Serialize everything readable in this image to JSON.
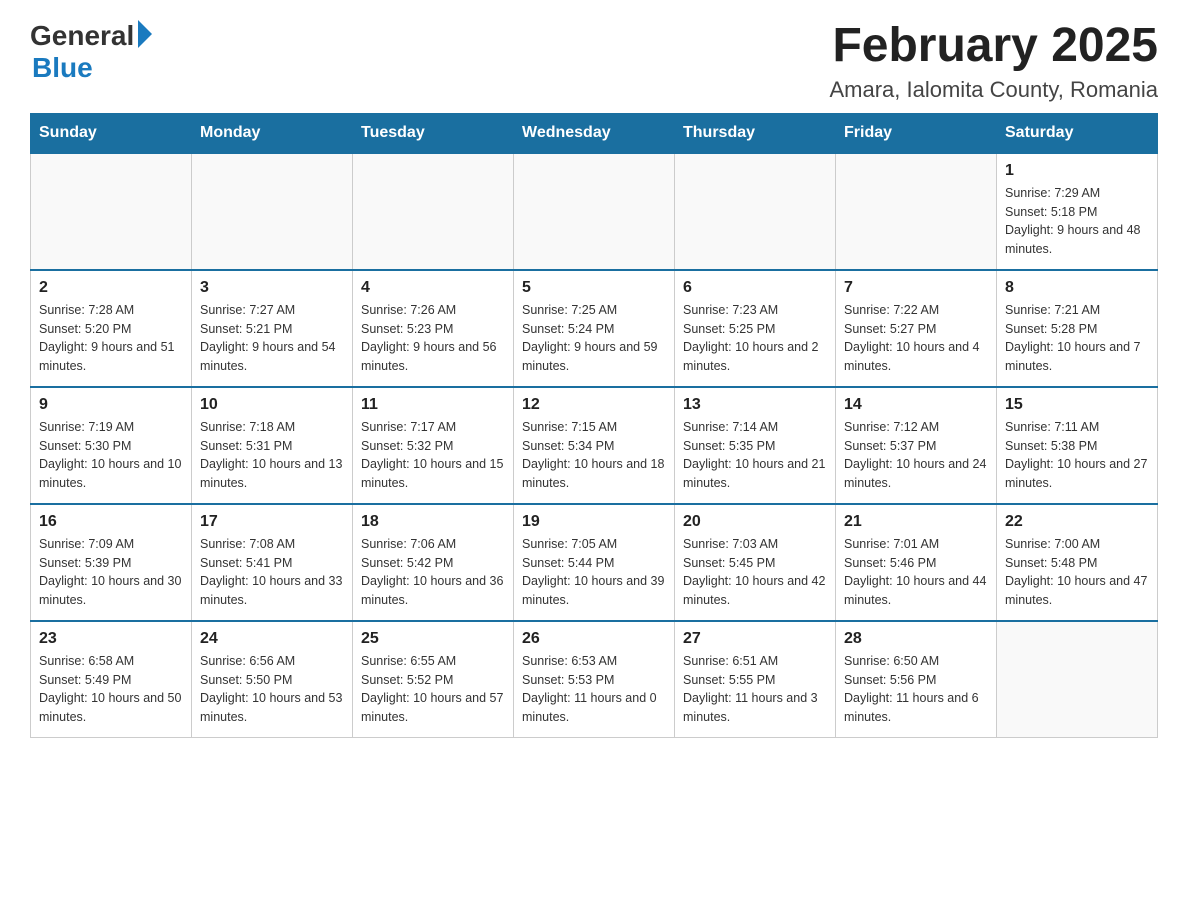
{
  "logo": {
    "general": "General",
    "blue": "Blue"
  },
  "title": "February 2025",
  "location": "Amara, Ialomita County, Romania",
  "days_header": [
    "Sunday",
    "Monday",
    "Tuesday",
    "Wednesday",
    "Thursday",
    "Friday",
    "Saturday"
  ],
  "weeks": [
    [
      {
        "day": "",
        "info": ""
      },
      {
        "day": "",
        "info": ""
      },
      {
        "day": "",
        "info": ""
      },
      {
        "day": "",
        "info": ""
      },
      {
        "day": "",
        "info": ""
      },
      {
        "day": "",
        "info": ""
      },
      {
        "day": "1",
        "info": "Sunrise: 7:29 AM\nSunset: 5:18 PM\nDaylight: 9 hours and 48 minutes."
      }
    ],
    [
      {
        "day": "2",
        "info": "Sunrise: 7:28 AM\nSunset: 5:20 PM\nDaylight: 9 hours and 51 minutes."
      },
      {
        "day": "3",
        "info": "Sunrise: 7:27 AM\nSunset: 5:21 PM\nDaylight: 9 hours and 54 minutes."
      },
      {
        "day": "4",
        "info": "Sunrise: 7:26 AM\nSunset: 5:23 PM\nDaylight: 9 hours and 56 minutes."
      },
      {
        "day": "5",
        "info": "Sunrise: 7:25 AM\nSunset: 5:24 PM\nDaylight: 9 hours and 59 minutes."
      },
      {
        "day": "6",
        "info": "Sunrise: 7:23 AM\nSunset: 5:25 PM\nDaylight: 10 hours and 2 minutes."
      },
      {
        "day": "7",
        "info": "Sunrise: 7:22 AM\nSunset: 5:27 PM\nDaylight: 10 hours and 4 minutes."
      },
      {
        "day": "8",
        "info": "Sunrise: 7:21 AM\nSunset: 5:28 PM\nDaylight: 10 hours and 7 minutes."
      }
    ],
    [
      {
        "day": "9",
        "info": "Sunrise: 7:19 AM\nSunset: 5:30 PM\nDaylight: 10 hours and 10 minutes."
      },
      {
        "day": "10",
        "info": "Sunrise: 7:18 AM\nSunset: 5:31 PM\nDaylight: 10 hours and 13 minutes."
      },
      {
        "day": "11",
        "info": "Sunrise: 7:17 AM\nSunset: 5:32 PM\nDaylight: 10 hours and 15 minutes."
      },
      {
        "day": "12",
        "info": "Sunrise: 7:15 AM\nSunset: 5:34 PM\nDaylight: 10 hours and 18 minutes."
      },
      {
        "day": "13",
        "info": "Sunrise: 7:14 AM\nSunset: 5:35 PM\nDaylight: 10 hours and 21 minutes."
      },
      {
        "day": "14",
        "info": "Sunrise: 7:12 AM\nSunset: 5:37 PM\nDaylight: 10 hours and 24 minutes."
      },
      {
        "day": "15",
        "info": "Sunrise: 7:11 AM\nSunset: 5:38 PM\nDaylight: 10 hours and 27 minutes."
      }
    ],
    [
      {
        "day": "16",
        "info": "Sunrise: 7:09 AM\nSunset: 5:39 PM\nDaylight: 10 hours and 30 minutes."
      },
      {
        "day": "17",
        "info": "Sunrise: 7:08 AM\nSunset: 5:41 PM\nDaylight: 10 hours and 33 minutes."
      },
      {
        "day": "18",
        "info": "Sunrise: 7:06 AM\nSunset: 5:42 PM\nDaylight: 10 hours and 36 minutes."
      },
      {
        "day": "19",
        "info": "Sunrise: 7:05 AM\nSunset: 5:44 PM\nDaylight: 10 hours and 39 minutes."
      },
      {
        "day": "20",
        "info": "Sunrise: 7:03 AM\nSunset: 5:45 PM\nDaylight: 10 hours and 42 minutes."
      },
      {
        "day": "21",
        "info": "Sunrise: 7:01 AM\nSunset: 5:46 PM\nDaylight: 10 hours and 44 minutes."
      },
      {
        "day": "22",
        "info": "Sunrise: 7:00 AM\nSunset: 5:48 PM\nDaylight: 10 hours and 47 minutes."
      }
    ],
    [
      {
        "day": "23",
        "info": "Sunrise: 6:58 AM\nSunset: 5:49 PM\nDaylight: 10 hours and 50 minutes."
      },
      {
        "day": "24",
        "info": "Sunrise: 6:56 AM\nSunset: 5:50 PM\nDaylight: 10 hours and 53 minutes."
      },
      {
        "day": "25",
        "info": "Sunrise: 6:55 AM\nSunset: 5:52 PM\nDaylight: 10 hours and 57 minutes."
      },
      {
        "day": "26",
        "info": "Sunrise: 6:53 AM\nSunset: 5:53 PM\nDaylight: 11 hours and 0 minutes."
      },
      {
        "day": "27",
        "info": "Sunrise: 6:51 AM\nSunset: 5:55 PM\nDaylight: 11 hours and 3 minutes."
      },
      {
        "day": "28",
        "info": "Sunrise: 6:50 AM\nSunset: 5:56 PM\nDaylight: 11 hours and 6 minutes."
      },
      {
        "day": "",
        "info": ""
      }
    ]
  ]
}
